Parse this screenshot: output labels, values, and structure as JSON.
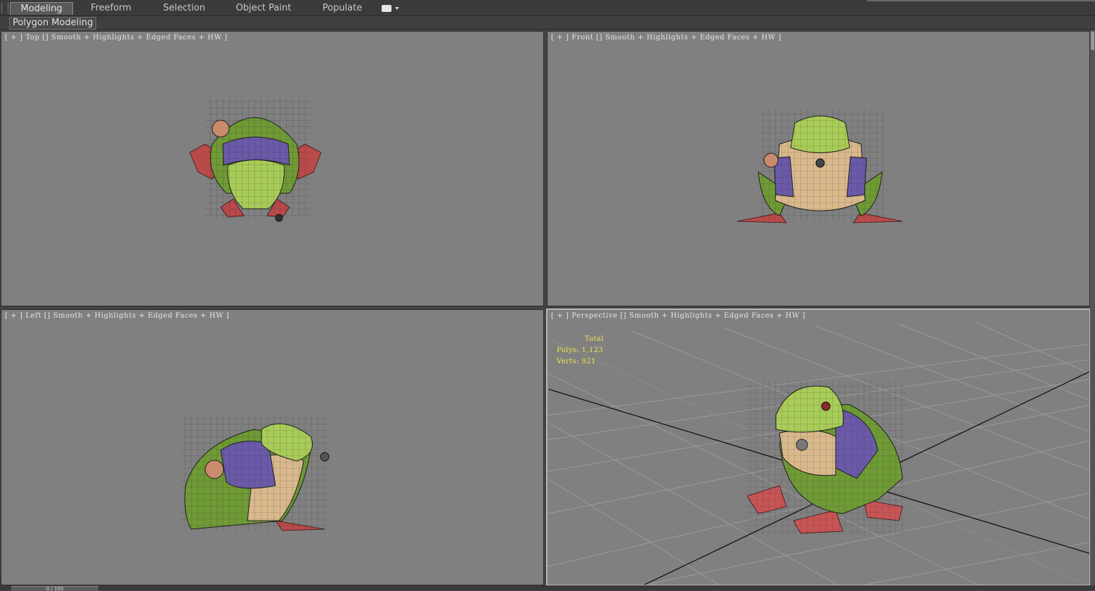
{
  "ribbon": {
    "tabs": [
      {
        "label": "Modeling",
        "active": true
      },
      {
        "label": "Freeform",
        "active": false
      },
      {
        "label": "Selection",
        "active": false
      },
      {
        "label": "Object Paint",
        "active": false
      },
      {
        "label": "Populate",
        "active": false
      }
    ],
    "panel_label": "Polygon Modeling",
    "dropdown_icon": "ribbon-options-icon"
  },
  "viewports": {
    "top": {
      "label": "[ + ] Top [] Smooth + Highlights + Edged Faces + HW ]"
    },
    "front": {
      "label": "[ + ] Front [] Smooth + Highlights + Edged Faces + HW ]"
    },
    "left": {
      "label": "[ + ] Left [] Smooth + Highlights + Edged Faces + HW ]"
    },
    "perspective": {
      "label": "[ + ] Perspective [] Smooth + Highlights + Edged Faces + HW ]",
      "active": true,
      "stats": {
        "title": "Total",
        "polys": "Polys: 1,123",
        "verts": "Verts: 921"
      }
    }
  },
  "time_slider": {
    "text": "0 / 100"
  },
  "colors": {
    "viewport_bg": "#808080",
    "ui_bg": "#444444",
    "stats_text": "#f0e44a",
    "frog_green": "#7da63a",
    "frog_belly": "#d9b98c",
    "vest_purple": "#6b5aa8",
    "feet_red": "#b84a4a"
  }
}
